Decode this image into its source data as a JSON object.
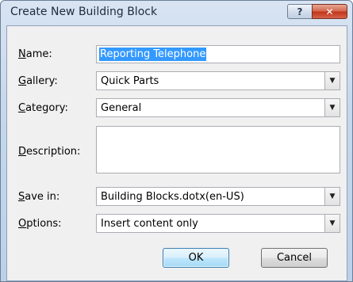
{
  "window": {
    "title": "Create New Building Block",
    "help_glyph": "?",
    "close_glyph": "✕"
  },
  "form": {
    "name": {
      "label_mn": "N",
      "label_rest": "ame:",
      "value": "Reporting Telephone"
    },
    "gallery": {
      "label_mn": "G",
      "label_rest": "allery:",
      "value": "Quick Parts"
    },
    "category": {
      "label_mn": "C",
      "label_rest": "ategory:",
      "value": "General"
    },
    "description": {
      "label_mn": "D",
      "label_rest": "escription:",
      "value": ""
    },
    "save_in": {
      "label_mn": "S",
      "label_rest": "ave in:",
      "value": "Building Blocks.dotx(en-US)"
    },
    "options": {
      "label_mn": "O",
      "label_rest": "ptions:",
      "value": "Insert content only"
    }
  },
  "buttons": {
    "ok": "OK",
    "cancel": "Cancel"
  },
  "icons": {
    "dropdown": "chevron-down-icon"
  }
}
